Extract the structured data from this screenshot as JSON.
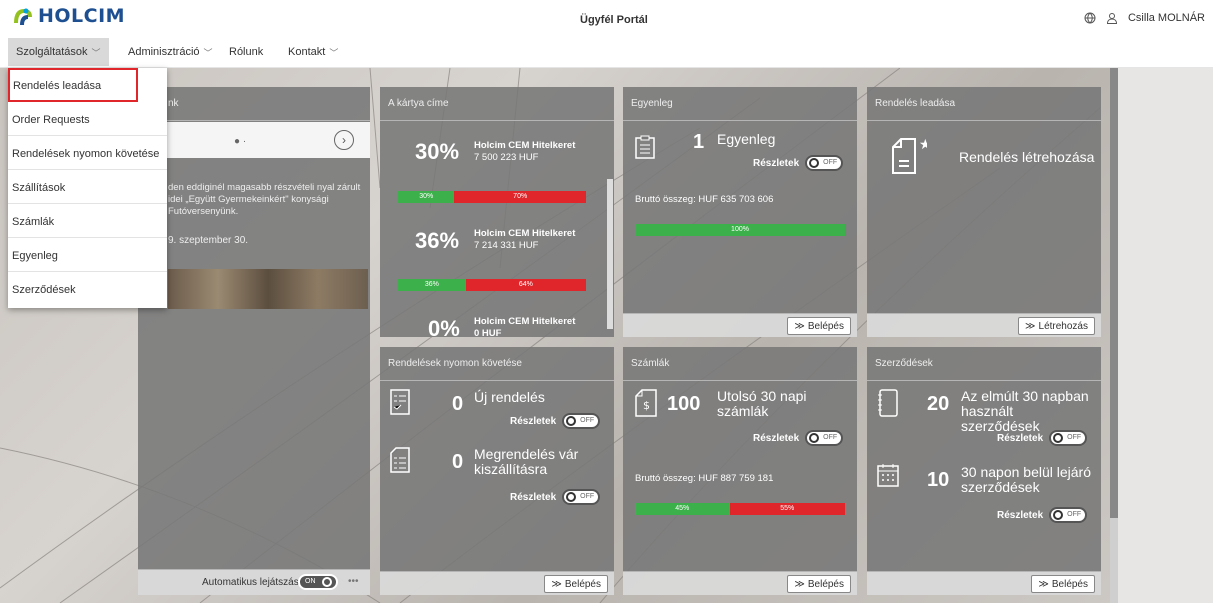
{
  "header": {
    "logo_text": "HOLCIM",
    "portal_title": "Ügyfél Portál",
    "user_name": "Csilla MOLNÁR",
    "icons": [
      "globe-icon",
      "user-icon"
    ]
  },
  "menu": {
    "items": [
      {
        "label": "Szolgáltatások"
      },
      {
        "label": "Adminisztráció"
      },
      {
        "label": "Rólunk"
      },
      {
        "label": "Kontakt"
      }
    ]
  },
  "dropdown": {
    "items": [
      {
        "label": "Rendelés leadása"
      },
      {
        "label": "Order Requests"
      },
      {
        "label": "Rendelések nyomon követése"
      },
      {
        "label": "Szállítások"
      },
      {
        "label": "Számlák"
      },
      {
        "label": "Egyenleg"
      },
      {
        "label": "Szerződések"
      }
    ]
  },
  "news": {
    "title_fragment": "nk",
    "text": "den eddiginél magasabb részvételi nyal zárult idei „Együtt Gyermekeinkért\" konysági Futóversenyünk.",
    "date": "9. szeptember 30.",
    "autoplay_label": "Automatikus lejátszás",
    "autoplay_toggle": "ON"
  },
  "card": {
    "title": "A kártya címe",
    "entries": [
      {
        "percent": "30%",
        "name": "Holcim CEM Hitelkeret",
        "amount": "7 500 223 HUF",
        "used": "30%",
        "free": "70%",
        "used_frac": 0.3
      },
      {
        "percent": "36%",
        "name": "Holcim CEM Hitelkeret",
        "amount": "7 214 331 HUF",
        "used": "36%",
        "free": "64%",
        "used_frac": 0.36
      },
      {
        "percent": "0%",
        "name": "Holcim CEM Hitelkeret",
        "amount": "0 HUF"
      }
    ]
  },
  "egyenleg": {
    "title": "Egyenleg",
    "count": "1",
    "label": "Egyenleg",
    "details": "Részletek",
    "toggle": "OFF",
    "brutto": "Bruttó összeg:  HUF 635 703 606",
    "bar_label": "100%",
    "bar_frac": 1.0,
    "button": "Belépés"
  },
  "rendeles": {
    "title": "Rendelés leadása",
    "label": "Rendelés létrehozása",
    "button": "Létrehozás"
  },
  "nyomon": {
    "title": "Rendelések nyomon követése",
    "items": [
      {
        "count": "0",
        "label": "Új rendelés",
        "details": "Részletek",
        "toggle": "OFF"
      },
      {
        "count": "0",
        "label": "Megrendelés vár kiszállításra",
        "details": "Részletek",
        "toggle": "OFF"
      }
    ],
    "button": "Belépés"
  },
  "szamlak": {
    "title": "Számlák",
    "count": "100",
    "label": "Utolsó 30 napi számlák",
    "details": "Részletek",
    "toggle": "OFF",
    "brutto": "Bruttó összeg:  HUF 887 759 181",
    "bar_green": "45%",
    "bar_red": "55%",
    "bar_frac": 0.45,
    "button": "Belépés"
  },
  "szerzodesek": {
    "title": "Szerződések",
    "items": [
      {
        "count": "20",
        "label": "Az elmúlt 30 napban használt szerződések",
        "details": "Részletek",
        "toggle": "OFF"
      },
      {
        "count": "10",
        "label": "30 napon belül lejáró szerződések",
        "details": "Részletek",
        "toggle": "OFF"
      }
    ],
    "button": "Belépés"
  }
}
